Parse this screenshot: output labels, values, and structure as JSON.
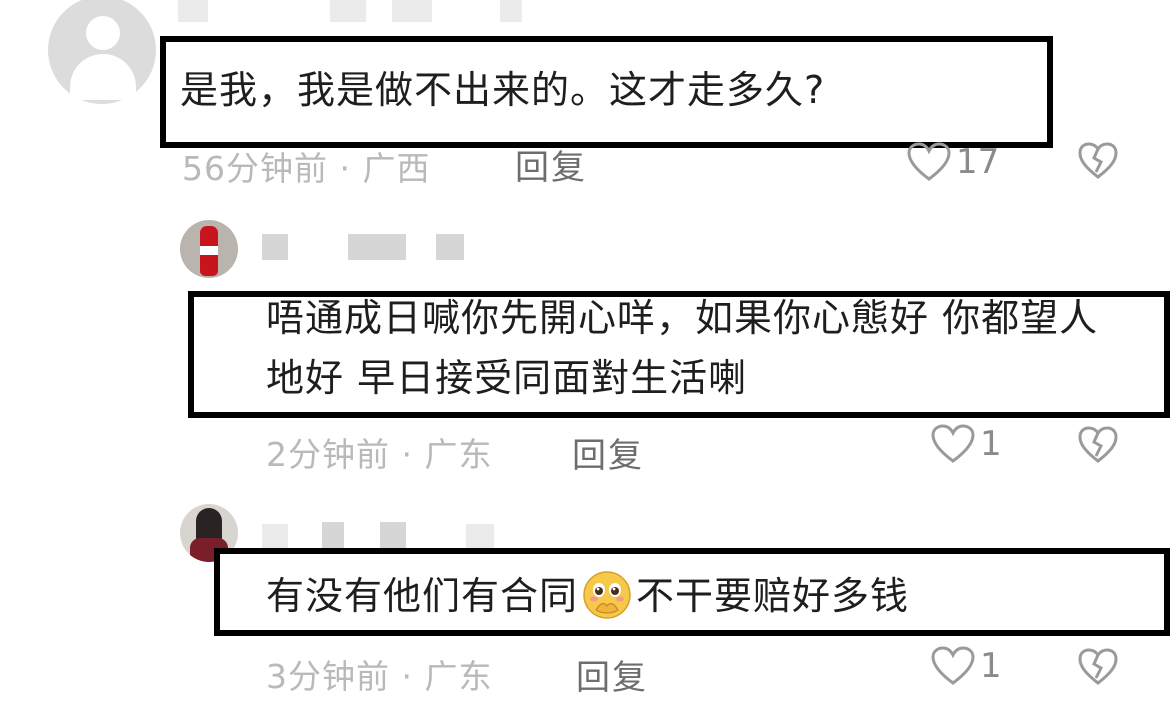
{
  "comments": [
    {
      "text": "是我，我是做不出来的。这才走多久?",
      "time": "56分钟前",
      "location": "广西",
      "reply_label": "回复",
      "likes": "17",
      "avatar": "default-avatar"
    },
    {
      "text": "唔通成日喊你先開心咩，如果你心態好 你都望人地好 早日接受同面對生活喇",
      "time": "2分钟前",
      "location": "广东",
      "reply_label": "回复",
      "likes": "1",
      "avatar": "cola-bottle-avatar"
    },
    {
      "text_before": "有没有他们有合同",
      "emoji": "pleading-face-emoji",
      "text_after": "不干要赔好多钱",
      "time": "3分钟前",
      "location": "广东",
      "reply_label": "回复",
      "likes": "1",
      "avatar": "person-photo-avatar"
    }
  ],
  "separator": " · ",
  "colors": {
    "highlight_border": "#000000",
    "meta_text": "#b9b9b9",
    "reply_text": "#6d6d6d",
    "icon_stroke": "#9a9a9a"
  },
  "icons": {
    "like": "heart-outline-icon",
    "dislike": "broken-heart-icon"
  }
}
